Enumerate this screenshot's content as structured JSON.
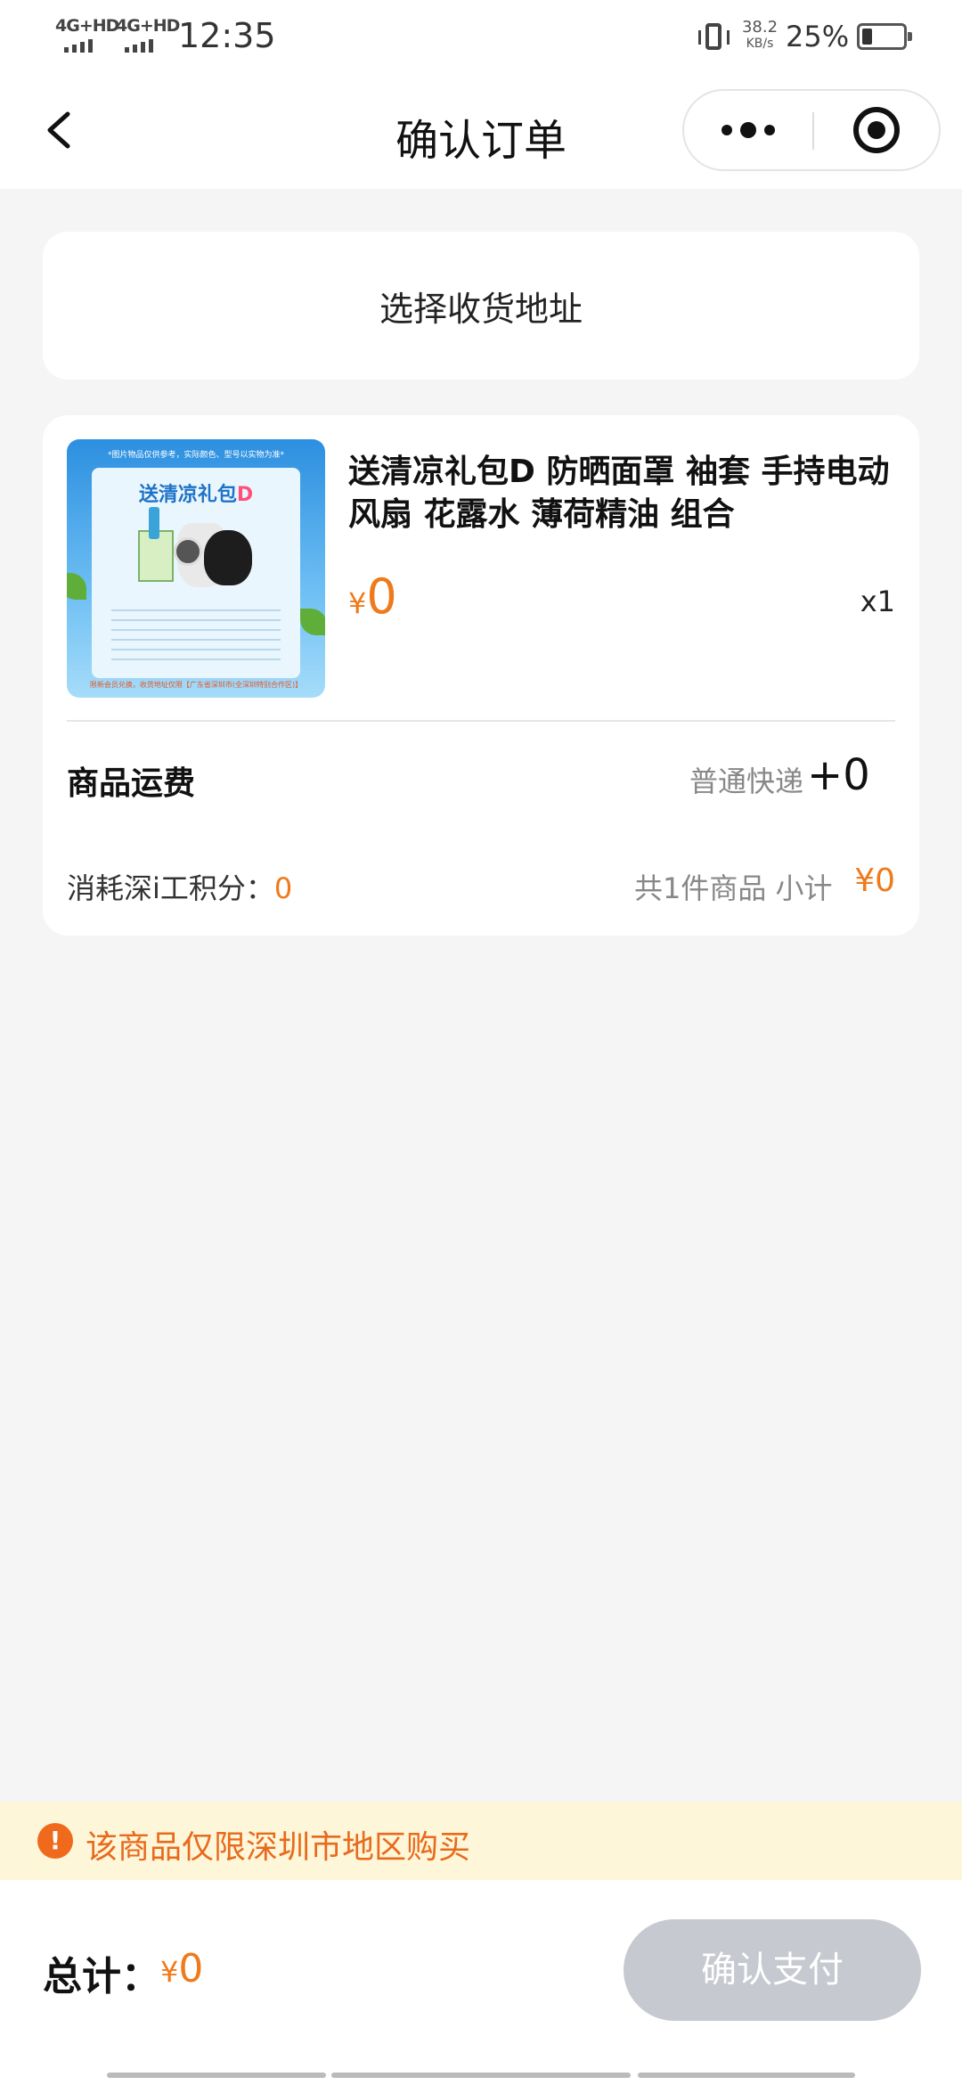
{
  "status_bar": {
    "net1": "4G+HD",
    "net2": "4G+HD",
    "time": "12:35",
    "speed_value": "38.2",
    "speed_unit": "KB/s",
    "battery_percent": "25%",
    "battery_level": 0.25
  },
  "nav": {
    "title": "确认订单",
    "back_icon": "chevron-left-icon",
    "more_icon": "more-dots-icon",
    "close_icon": "target-circle-icon"
  },
  "address": {
    "label": "选择收货地址"
  },
  "order": {
    "product_name": "送清凉礼包D 防晒面罩 袖套 手持电动风扇 花露水 薄荷精油 组合",
    "price_symbol": "¥",
    "price_value": "0",
    "quantity": "x1",
    "shipping_label": "商品运费",
    "shipping_method": "普通快递",
    "shipping_fee": "+0",
    "points_label": "消耗深i工积分：",
    "points_value": "0",
    "subtotal_label": "共1件商品 小计",
    "subtotal_value": "¥0",
    "thumbnail": {
      "title": "送清凉礼包",
      "title_letter": "D",
      "top_note": "*图片物品仅供参考，实际颜色、型号以实物为准*",
      "footer_note": "限新会员兑换，收货地址仅限【广东省深圳市(全深圳特别合作区)】"
    }
  },
  "notice": {
    "icon": "exclamation-icon",
    "text": "该商品仅限深圳市地区购买"
  },
  "footer": {
    "total_label": "总计：",
    "total_symbol": "¥",
    "total_value": "0",
    "pay_button": "确认支付"
  },
  "colors": {
    "accent": "#ef7a1b",
    "notice_bg": "#fdf6d8",
    "button_disabled": "#c6c9cf",
    "page_bg": "#f5f5f5"
  }
}
